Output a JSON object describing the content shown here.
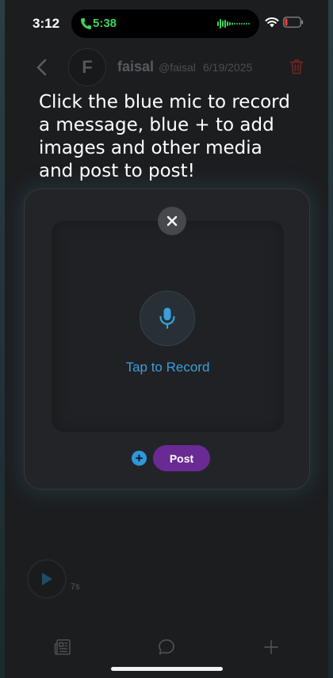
{
  "status_bar": {
    "time": "3:12",
    "call_timer": "5:38"
  },
  "post": {
    "avatar_initial": "F",
    "author": "faisal",
    "handle": "@faisal",
    "date": "6/19/2025",
    "audio_duration": "7s"
  },
  "hint": {
    "text": "Click the blue mic to record\n a message, blue + to add\n images and other media\nand post to post!"
  },
  "record_modal": {
    "record_label": "Tap to Record",
    "add_media_label": "+",
    "post_label": "Post"
  },
  "tabs": [
    {
      "icon": "newspaper-icon"
    },
    {
      "icon": "chat-bubble-icon"
    },
    {
      "icon": "plus-icon"
    }
  ],
  "colors": {
    "accent_blue": "#2f98da",
    "post_purple": "#6a2a94",
    "call_green": "#3ed35a",
    "delete_red": "#6e2424"
  }
}
